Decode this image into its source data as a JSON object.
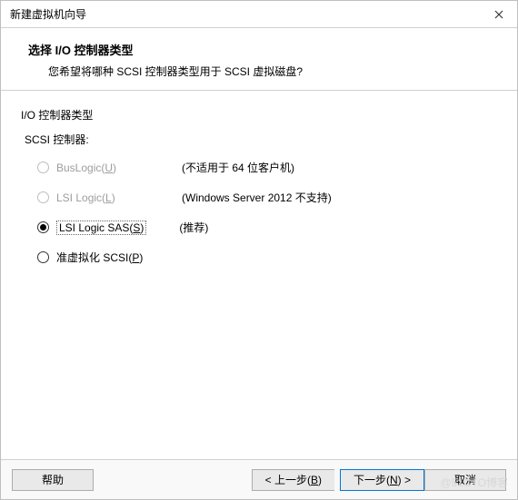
{
  "titlebar": {
    "title": "新建虚拟机向导"
  },
  "header": {
    "heading": "选择 I/O 控制器类型",
    "subheading": "您希望将哪种 SCSI 控制器类型用于 SCSI 虚拟磁盘?"
  },
  "group": {
    "label": "I/O 控制器类型",
    "scsi_label": "SCSI 控制器:"
  },
  "options": {
    "buslogic": {
      "label_pre": "BusLogic(",
      "label_key": "U",
      "label_post": ")",
      "note": "(不适用于 64 位客户机)"
    },
    "lsilogic": {
      "label_pre": "LSI Logic(",
      "label_key": "L",
      "label_post": ")",
      "note": "(Windows Server 2012 不支持)"
    },
    "lsisas": {
      "label_pre": "LSI Logic SAS(",
      "label_key": "S",
      "label_post": ")",
      "note": "(推荐)"
    },
    "paravirt": {
      "label_pre": "准虚拟化 SCSI(",
      "label_key": "P",
      "label_post": ")"
    }
  },
  "footer": {
    "help": "帮助",
    "back_pre": "< 上一步(",
    "back_key": "B",
    "back_post": ")",
    "next_pre": "下一步(",
    "next_key": "N",
    "next_post": ") >",
    "cancel": "取消"
  },
  "watermark": "@51CTO博客"
}
